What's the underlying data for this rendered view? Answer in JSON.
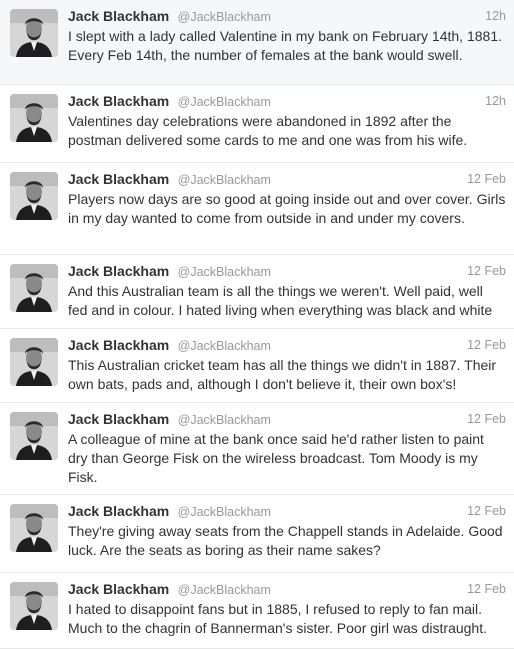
{
  "profile": {
    "display_name": "Jack Blackham",
    "handle": "@JackBlackham",
    "avatar_icon": "portrait-photo-icon"
  },
  "colors": {
    "name": "#333333",
    "meta": "#999999",
    "divider": "#e8e8e8",
    "background": "#ffffff"
  },
  "tweets": [
    {
      "time": "12h",
      "text": "I slept with a lady called Valentine in my bank on February 14th, 1881. Every Feb 14th, the number of females at the bank would swell."
    },
    {
      "time": "12h",
      "text": "Valentines day celebrations were abandoned in 1892 after the postman delivered some cards to me and one was from his wife."
    },
    {
      "time": "12 Feb",
      "text": "Players now days are so good at going inside out and over cover. Girls in my day wanted to come from outside in and under my covers."
    },
    {
      "time": "12 Feb",
      "text": "And this Australian team is all the things we weren't. Well paid, well fed and in colour. I hated living when everything was black and white"
    },
    {
      "time": "12 Feb",
      "text": "This Australian cricket team has all the things we didn't in 1887. Their own bats, pads and, although I don't believe it, their own box's!"
    },
    {
      "time": "12 Feb",
      "text": "A colleague of mine at the bank once said he'd rather listen to paint dry than George Fisk on the wireless broadcast. Tom Moody is my Fisk."
    },
    {
      "time": "12 Feb",
      "text": "They're giving away seats from the Chappell stands in Adelaide. Good luck. Are the seats as boring as their name sakes?"
    },
    {
      "time": "12 Feb",
      "text": "I hated to disappoint fans but in 1885, I refused to reply to fan mail. Much to the chagrin of Bannerman's sister. Poor girl was distraught."
    }
  ]
}
